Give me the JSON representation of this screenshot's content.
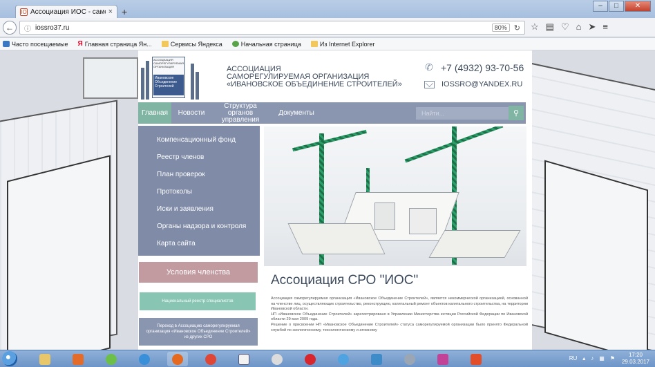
{
  "browser": {
    "tab_title": "Ассоциация ИОС - самор...",
    "tab_close": "×",
    "new_tab": "+",
    "url": "iossro37.ru",
    "zoom": "80%",
    "bookmarks": [
      "Часто посещаемые",
      "Главная страница Ян...",
      "Сервисы Яндекса",
      "Начальная страница",
      "Из Internet Explorer"
    ]
  },
  "header": {
    "logo_small": "АССОЦИАЦИЯ САМОРЕГУЛИРУЕМАЯ ОРГАНИЗАЦИЯ",
    "logo_blue": [
      "Ивановское",
      "Объединение",
      "Строителей"
    ],
    "org_lines": [
      "АССОЦИАЦИЯ",
      "САМОРЕГУЛИРУЕМАЯ ОРГАНИЗАЦИЯ",
      "«ИВАНОВСКОЕ ОБЪЕДИНЕНИЕ СТРОИТЕЛЕЙ»"
    ],
    "phone": "+7 (4932) 93-70-56",
    "email": "IOSSRO@YANDEX.RU"
  },
  "menu": {
    "items": [
      "Главная",
      "Новости",
      "Структура органов управления",
      "Документы"
    ],
    "search_placeholder": "Найти..."
  },
  "sidebar": {
    "items": [
      "Компенсационный фонд",
      "Реестр членов",
      "План проверок",
      "Протоколы",
      "Иски и заявления",
      "Органы надзора и контроля",
      "Карта сайта"
    ],
    "terms_button": "Условия членства",
    "registry_button": "Национальный реестр специалистов",
    "transfer_button": "Переход в Ассоциацию саморегулируемая организация «Ивановское Объединение Строителей» из других СРО"
  },
  "main": {
    "title": "Ассоциация СРО \"ИОС\"",
    "paragraphs": [
      "Ассоциация саморегулируемая организация «Ивановское Объединение Строителей», является некоммерческой организацией, основанной на членстве лиц, осуществляющих строительство, реконструкцию, капитальный ремонт объектов капитального строительства, на территории Ивановской области.",
      "НП «Ивановское Объединение Строителей» зарегистрировано в Управлении Министерства юстиции Российской Федерации по Ивановской области 29 мая 2009 года.",
      "Решение о присвоении НП «Ивановское Объединение Строителей» статуса саморегулируемой организации было принято Федеральной службой по экологическому, технологическому и атомному"
    ]
  },
  "taskbar": {
    "lang": "RU",
    "time": "17:20",
    "date": "29.03.2017"
  },
  "colors": {
    "menu_bg": "#8a96b0",
    "accent_green": "#7fb5a2",
    "terms_pink": "#c29ba0",
    "registry_teal": "#88c5b3",
    "text_dark": "#3c4a5c"
  }
}
